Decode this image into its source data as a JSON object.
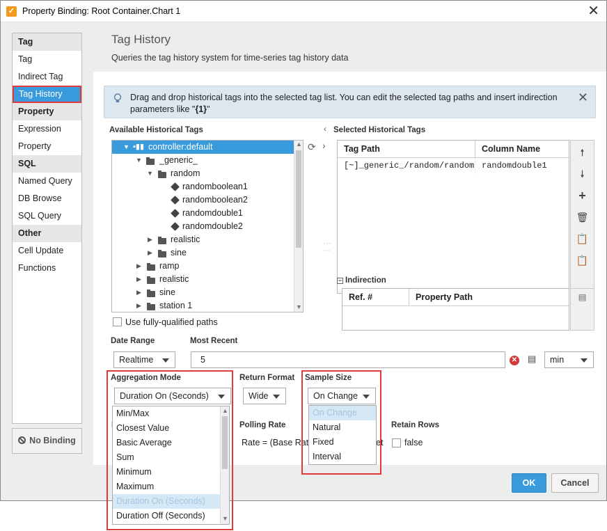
{
  "window": {
    "title": "Property Binding: Root Container.Chart 1",
    "app_icon": "ignition-icon"
  },
  "sidebar": {
    "categories": [
      {
        "label": "Tag",
        "items": [
          {
            "label": "Tag"
          },
          {
            "label": "Indirect Tag"
          },
          {
            "label": "Tag History",
            "selected": true
          }
        ]
      },
      {
        "label": "Property",
        "items": [
          {
            "label": "Expression"
          },
          {
            "label": "Property"
          }
        ]
      },
      {
        "label": "SQL",
        "items": [
          {
            "label": "Named Query"
          },
          {
            "label": "DB Browse"
          },
          {
            "label": "SQL Query"
          }
        ]
      },
      {
        "label": "Other",
        "items": [
          {
            "label": "Cell Update"
          },
          {
            "label": "Functions"
          }
        ]
      }
    ],
    "no_binding_label": "No Binding"
  },
  "main": {
    "title": "Tag History",
    "subtitle": "Queries the tag history system for time-series tag history data",
    "info": {
      "text_prefix": "Drag and drop historical tags into the selected tag list. You can edit the selected tag paths and insert indirection parameters like \"",
      "text_bold": "{1}",
      "text_suffix": "\""
    },
    "available_label": "Available Historical Tags",
    "selected_label": "Selected Historical Tags",
    "tree": [
      {
        "label": "controller:default",
        "selected": true
      },
      {
        "label": "_generic_"
      },
      {
        "label": "random"
      },
      {
        "label": "randomboolean1"
      },
      {
        "label": "randomboolean2"
      },
      {
        "label": "randomdouble1"
      },
      {
        "label": "randomdouble2"
      },
      {
        "label": "realistic"
      },
      {
        "label": "sine"
      },
      {
        "label": "ramp"
      },
      {
        "label": "realistic"
      },
      {
        "label": "sine"
      },
      {
        "label": "station 1"
      }
    ],
    "selected_table": {
      "headers": [
        "Tag Path",
        "Column Name"
      ],
      "rows": [
        [
          "[~]_generic_/random/randomd",
          "randomdouble1"
        ]
      ]
    },
    "indirection": {
      "label": "Indirection",
      "headers": [
        "Ref. #",
        "Property Path"
      ]
    },
    "use_fq_label": "Use fully-qualified paths",
    "date_range": {
      "label": "Date Range",
      "value": "Realtime"
    },
    "most_recent": {
      "label": "Most Recent",
      "value": "5",
      "unit": "min"
    },
    "aggregation": {
      "label": "Aggregation Mode",
      "value": "Duration On (Seconds)",
      "options": [
        "Min/Max",
        "Closest Value",
        "Basic Average",
        "Sum",
        "Minimum",
        "Maximum",
        "Duration On (Seconds)",
        "Duration Off (Seconds)"
      ]
    },
    "return_format": {
      "label": "Return Format",
      "value": "Wide"
    },
    "sample_size": {
      "label": "Sample Size",
      "value": "On Change",
      "options": [
        "On Change",
        "Natural",
        "Fixed",
        "Interval"
      ]
    },
    "polling_rate": {
      "label": "Polling Rate",
      "value": "Rate = (Base Rate"
    },
    "retain_rows": {
      "label": "Retain Rows",
      "value": "false"
    },
    "partial_text": "et"
  },
  "footer": {
    "ok": "OK",
    "cancel": "Cancel"
  },
  "colors": {
    "accent": "#3a9bdc",
    "highlight_box": "#e03a3a"
  }
}
